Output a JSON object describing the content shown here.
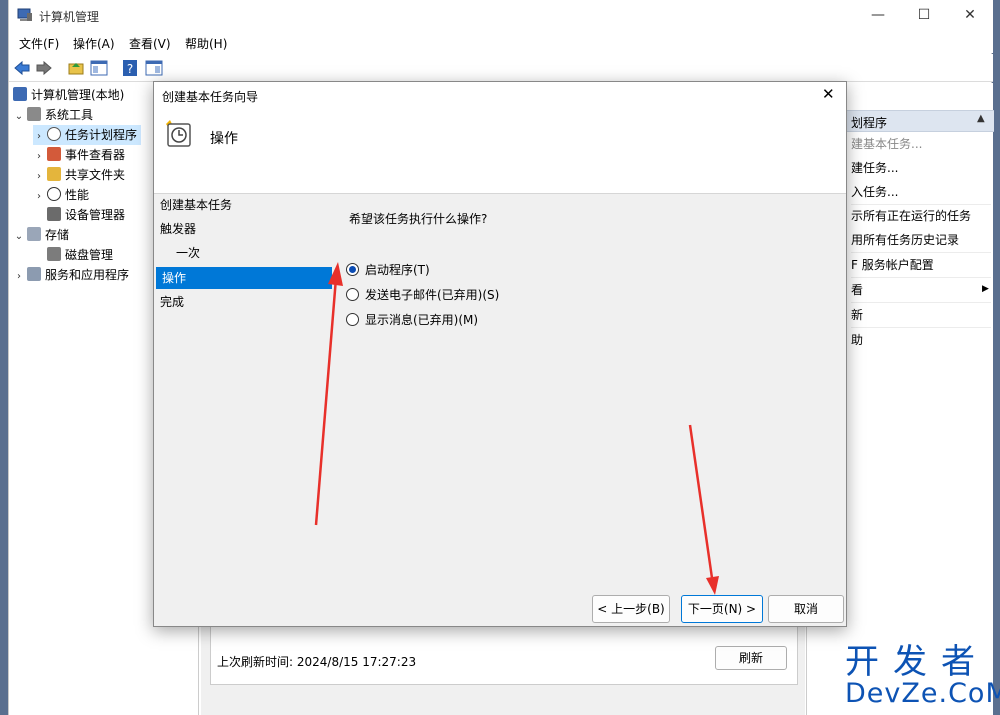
{
  "window": {
    "title": "计算机管理",
    "menu": [
      "文件(F)",
      "操作(A)",
      "查看(V)",
      "帮助(H)"
    ]
  },
  "tree": {
    "root": "计算机管理(本地)",
    "items": [
      {
        "label": "系统工具",
        "icon": "tools-icon"
      },
      {
        "label": "任务计划程序",
        "icon": "clock-icon"
      },
      {
        "label": "事件查看器",
        "icon": "event-viewer-icon"
      },
      {
        "label": "共享文件夹",
        "icon": "shared-folder-icon"
      },
      {
        "label": "性能",
        "icon": "performance-icon"
      },
      {
        "label": "设备管理器",
        "icon": "device-manager-icon"
      },
      {
        "label": "存储",
        "icon": "storage-icon"
      },
      {
        "label": "磁盘管理",
        "icon": "disk-icon"
      },
      {
        "label": "服务和应用程序",
        "icon": "services-icon"
      }
    ]
  },
  "actions": {
    "header": "划程序",
    "items": [
      "建基本任务...",
      "建任务...",
      "入任务...",
      "示所有正在运行的任务",
      "用所有任务历史记录",
      "F 服务帐户配置",
      "看",
      "新",
      "助"
    ]
  },
  "bottom": {
    "refresh_time": "上次刷新时间: 2024/8/15 17:27:23",
    "refresh_button": "刷新"
  },
  "dialog": {
    "title": "创建基本任务向导",
    "close": "✕",
    "banner_title": "操作",
    "steps": [
      "创建基本任务",
      "触发器",
      "一次",
      "操作",
      "完成"
    ],
    "question": "希望该任务执行什么操作?",
    "options": [
      {
        "label": "启动程序(T)",
        "selected": true
      },
      {
        "label": "发送电子邮件(已弃用)(S)",
        "selected": false
      },
      {
        "label": "显示消息(已弃用)(M)",
        "selected": false
      }
    ],
    "buttons": {
      "back": "< 上一步(B)",
      "next": "下一页(N) >",
      "cancel": "取消"
    }
  },
  "watermark": {
    "line1": "开发者",
    "line2": "DevZe.CoM"
  },
  "colors": {
    "accent": "#0078d7",
    "arrow": "#e8302a"
  }
}
